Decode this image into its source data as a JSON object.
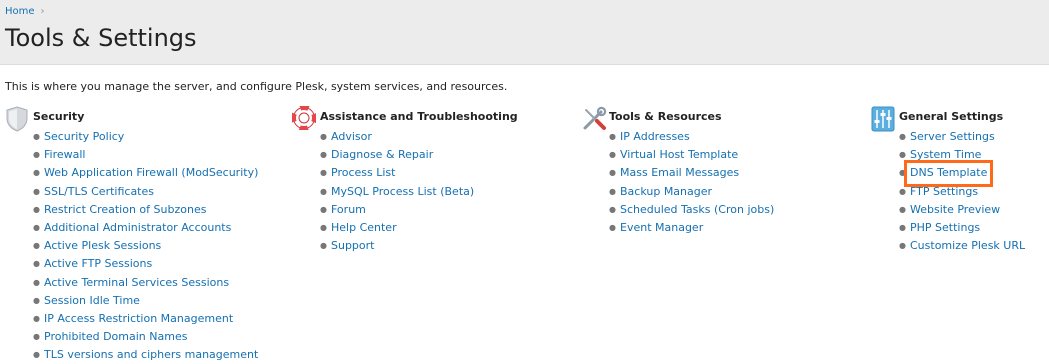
{
  "breadcrumb": {
    "home": "Home",
    "separator": "›"
  },
  "page": {
    "title": "Tools & Settings",
    "intro": "This is where you manage the server, and configure Plesk, system services, and resources."
  },
  "colors": {
    "link": "#1570b1",
    "header_bg": "#ececec",
    "highlight": "#ff6a1a"
  },
  "sections": [
    {
      "title": "Security",
      "icon": "shield-icon",
      "items": [
        "Security Policy",
        "Firewall",
        "Web Application Firewall (ModSecurity)",
        "SSL/TLS Certificates",
        "Restrict Creation of Subzones",
        "Additional Administrator Accounts",
        "Active Plesk Sessions",
        "Active FTP Sessions",
        "Active Terminal Services Sessions",
        "Session Idle Time",
        "IP Access Restriction Management",
        "Prohibited Domain Names",
        "TLS versions and ciphers management"
      ]
    },
    {
      "title": "Assistance and Troubleshooting",
      "icon": "lifebuoy-icon",
      "items": [
        "Advisor",
        "Diagnose & Repair",
        "Process List",
        "MySQL Process List (Beta)",
        "Forum",
        "Help Center",
        "Support"
      ]
    },
    {
      "title": "Tools & Resources",
      "icon": "wrench-screwdriver-icon",
      "items": [
        "IP Addresses",
        "Virtual Host Template",
        "Mass Email Messages",
        "Backup Manager",
        "Scheduled Tasks (Cron jobs)",
        "Event Manager"
      ]
    },
    {
      "title": "General Settings",
      "icon": "sliders-icon",
      "highlighted_item": "DNS Template",
      "items": [
        "Server Settings",
        "System Time",
        "DNS Template",
        "FTP Settings",
        "Website Preview",
        "PHP Settings",
        "Customize Plesk URL"
      ]
    }
  ]
}
